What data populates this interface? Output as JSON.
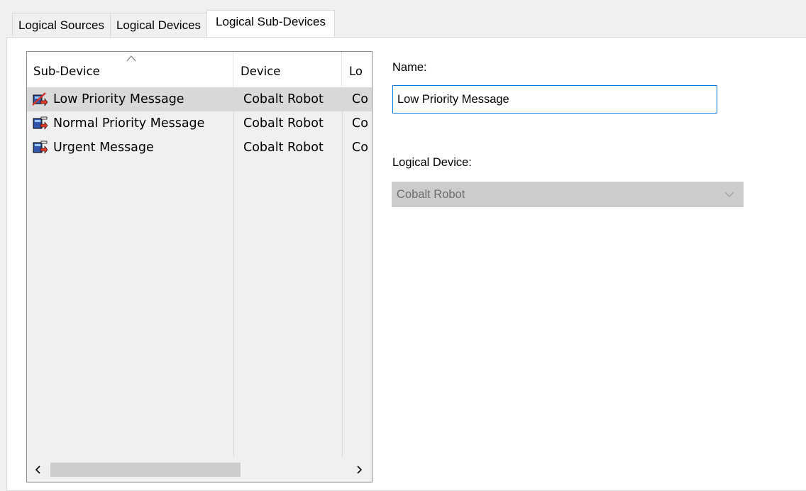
{
  "tabs": [
    {
      "label": "Logical Sources"
    },
    {
      "label": "Logical Devices"
    },
    {
      "label": "Logical Sub-Devices"
    }
  ],
  "list": {
    "columns": [
      {
        "label": "Sub-Device"
      },
      {
        "label": "Device"
      },
      {
        "label": "Lo"
      }
    ],
    "rows": [
      {
        "name": "Low Priority Message",
        "device": "Cobalt Robot",
        "third": "Co",
        "icon": "low-priority-subdevice-icon",
        "selected": true
      },
      {
        "name": "Normal Priority Message",
        "device": "Cobalt Robot",
        "third": "Co",
        "icon": "subdevice-icon",
        "selected": false
      },
      {
        "name": "Urgent Message",
        "device": "Cobalt Robot",
        "third": "Co",
        "icon": "subdevice-icon",
        "selected": false
      }
    ]
  },
  "form": {
    "name_label": "Name:",
    "name_value": "Low Priority Message",
    "device_label": "Logical Device:",
    "device_value": "Cobalt Robot"
  },
  "colors": {
    "selected_row": "#d9d9d9",
    "focus_border": "#0078d7",
    "disabled_combo": "#cccccc"
  }
}
